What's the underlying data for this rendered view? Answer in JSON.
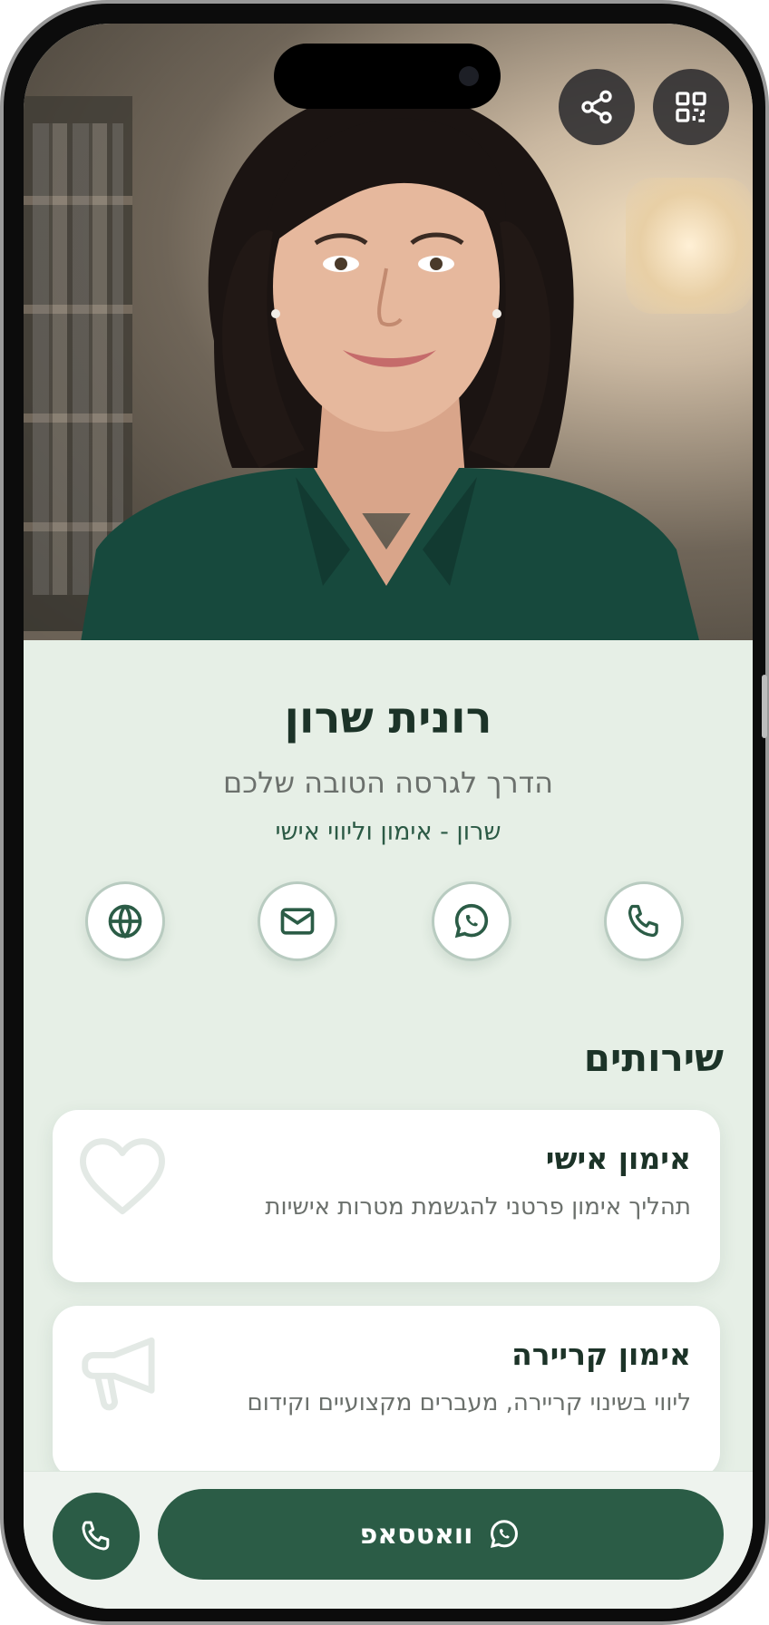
{
  "profile": {
    "name": "רונית שרון",
    "tagline": "הדרך לגרסה הטובה שלכם",
    "business": "שרון - אימון וליווי אישי"
  },
  "top_actions": [
    {
      "icon": "share-icon"
    },
    {
      "icon": "qr-code-icon"
    }
  ],
  "contact_actions": [
    {
      "icon": "phone-icon"
    },
    {
      "icon": "whatsapp-icon"
    },
    {
      "icon": "mail-icon"
    },
    {
      "icon": "globe-icon"
    }
  ],
  "services": {
    "title": "שירותים",
    "items": [
      {
        "title": "אימון אישי",
        "description": "תהליך אימון פרטני להגשמת מטרות אישיות",
        "icon": "heart-icon"
      },
      {
        "title": "אימון קריירה",
        "description": "ליווי בשינוי קריירה, מעברים מקצועיים וקידום",
        "icon": "megaphone-icon"
      }
    ]
  },
  "bottom_bar": {
    "whatsapp_label": "וואטסאפ"
  },
  "colors": {
    "primary": "#2b5c46",
    "background": "#e6efe6",
    "text_dark": "#1c3328"
  }
}
